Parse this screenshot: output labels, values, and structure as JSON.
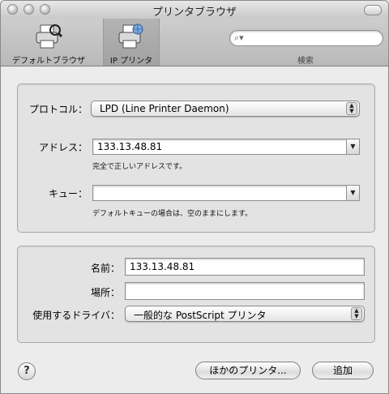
{
  "window": {
    "title": "プリンタブラウザ"
  },
  "toolbar": {
    "items": [
      {
        "label": "デフォルトブラウザ",
        "icon": "printer-icon"
      },
      {
        "label": "IP プリンタ",
        "icon": "network-printer-icon",
        "selected": true
      }
    ],
    "search": {
      "label": "検索",
      "placeholder": "",
      "icon": "search-icon"
    }
  },
  "connection": {
    "protocol_label": "プロトコル：",
    "protocol_value": "LPD (Line Printer Daemon)",
    "address_label": "アドレス：",
    "address_value": "133.13.48.81",
    "address_hint": "完全で正しいアドレスです。",
    "queue_label": "キュー：",
    "queue_value": "",
    "queue_hint": "デフォルトキューの場合は、空のままにします。"
  },
  "details": {
    "name_label": "名前：",
    "name_value": "133.13.48.81",
    "location_label": "場所：",
    "location_value": "",
    "driver_label": "使用するドライバ：",
    "driver_value": "一般的な PostScript プリンタ"
  },
  "buttons": {
    "help": "?",
    "other_printers": "ほかのプリンタ...",
    "add": "追加"
  }
}
